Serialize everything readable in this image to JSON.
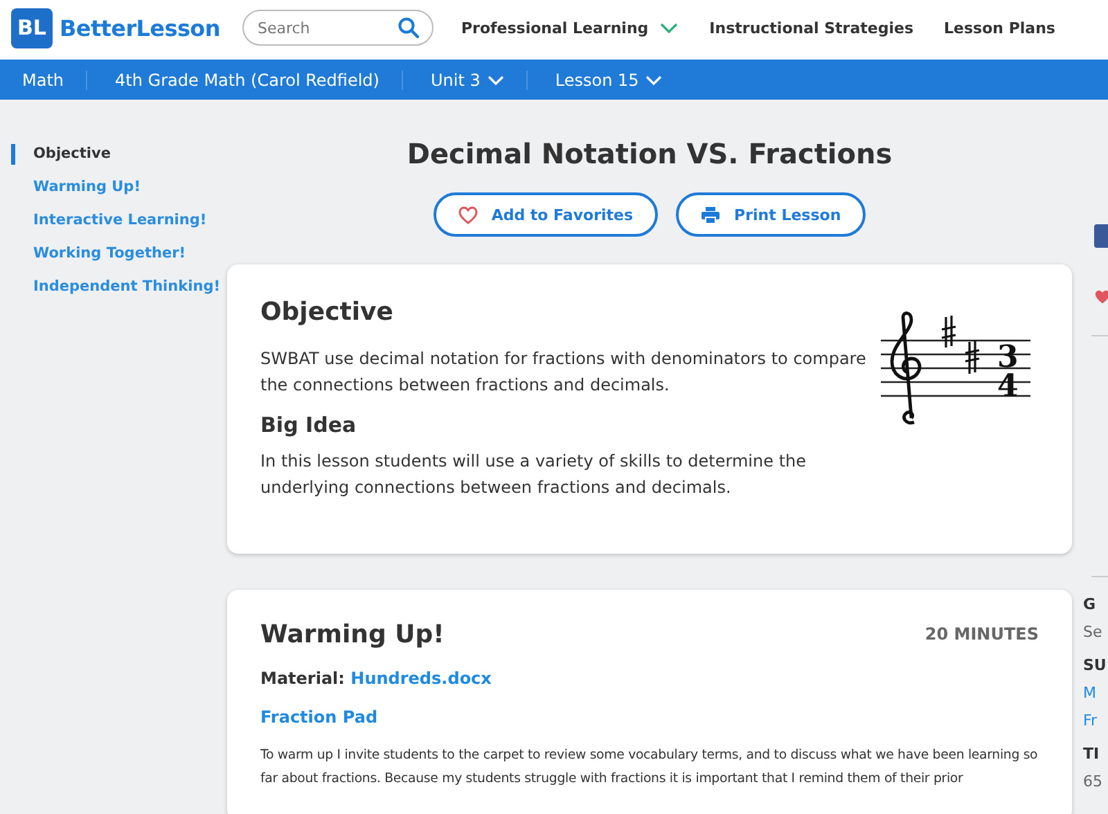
{
  "header": {
    "logo_mark": "BL",
    "logo_text": "BetterLesson",
    "search": {
      "placeholder": "Search"
    },
    "nav": [
      {
        "label": "Professional Learning",
        "dropdown": true
      },
      {
        "label": "Instructional Strategies",
        "dropdown": false
      },
      {
        "label": "Lesson Plans",
        "dropdown": false
      }
    ]
  },
  "breadcrumb": [
    {
      "label": "Math",
      "dropdown": false
    },
    {
      "label": "4th Grade Math (Carol Redfield)",
      "dropdown": false
    },
    {
      "label": "Unit 3",
      "dropdown": true
    },
    {
      "label": "Lesson 15",
      "dropdown": true
    }
  ],
  "sidebar": {
    "items": [
      {
        "label": "Objective",
        "selected": true
      },
      {
        "label": "Warming Up!",
        "selected": false
      },
      {
        "label": "Interactive Learning!",
        "selected": false
      },
      {
        "label": "Working Together!",
        "selected": false
      },
      {
        "label": "Independent Thinking!",
        "selected": false
      }
    ]
  },
  "lesson": {
    "title": "Decimal Notation VS. Fractions",
    "buttons": [
      {
        "kind": "favorite",
        "label": "Add to Favorites"
      },
      {
        "kind": "print",
        "label": "Print Lesson"
      }
    ],
    "objective": {
      "heading": "Objective",
      "text": "SWBAT use decimal notation for fractions with denominators to compare the connections between fractions and decimals.",
      "big_idea_heading": "Big Idea",
      "big_idea_text": "In this lesson students will use a variety of skills to determine the underlying connections between fractions and decimals.",
      "time_signature": [
        "3",
        "4"
      ]
    },
    "warm_up": {
      "heading": "Warming Up!",
      "duration": "20 MINUTES",
      "material_label": "Material:",
      "material_link": "Hundreds.docx",
      "link": "Fraction Pad",
      "text": "To warm up I invite students to the carpet to review some vocabulary terms, and to discuss what we have been learning so far about fractions.  Because my students struggle with fractions it is important that I remind them of their prior"
    }
  },
  "right_panel": {
    "texts": [
      {
        "kind": "label",
        "text": "G"
      },
      {
        "kind": "value",
        "text": "Se"
      },
      {
        "kind": "label",
        "text": "SU"
      },
      {
        "kind": "link",
        "text": "M"
      },
      {
        "kind": "link",
        "text": "Fr"
      },
      {
        "kind": "label",
        "text": "TI"
      },
      {
        "kind": "value",
        "text": "65"
      }
    ]
  }
}
